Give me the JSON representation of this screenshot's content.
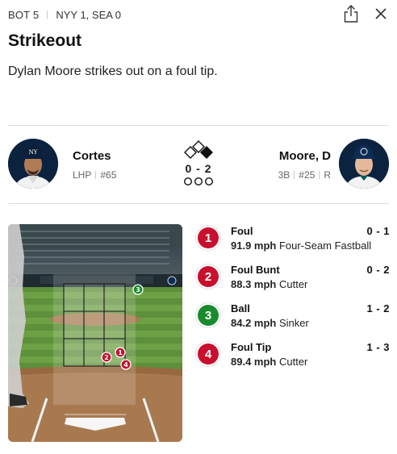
{
  "header": {
    "inning": "BOT 5",
    "score": "NYY 1, SEA 0"
  },
  "play": {
    "title": "Strikeout",
    "description": "Dylan Moore strikes out on a foul tip."
  },
  "pitcher": {
    "name": "Cortes",
    "position": "LHP",
    "number": "#65"
  },
  "batter": {
    "name": "Moore, D",
    "position": "3B",
    "number": "#25",
    "bats": "R"
  },
  "situation": {
    "count": "0 - 2",
    "bases": {
      "first": false,
      "second": false,
      "third": false
    },
    "outs": 0
  },
  "pitches": [
    {
      "num": "1",
      "result": "Foul",
      "count": "0 - 1",
      "speed": "91.9 mph",
      "type": "Four-Seam Fastball",
      "kind": "strike"
    },
    {
      "num": "2",
      "result": "Foul Bunt",
      "count": "0 - 2",
      "speed": "88.3 mph",
      "type": "Cutter",
      "kind": "strike"
    },
    {
      "num": "3",
      "result": "Ball",
      "count": "1 - 2",
      "speed": "84.2 mph",
      "type": "Sinker",
      "kind": "ball"
    },
    {
      "num": "4",
      "result": "Foul Tip",
      "count": "1 - 3",
      "speed": "89.4 mph",
      "type": "Cutter",
      "kind": "strike"
    }
  ],
  "colors": {
    "strike": "#c8102e",
    "ball": "#1a8a2e",
    "mariners_navy": "#0c2340"
  }
}
